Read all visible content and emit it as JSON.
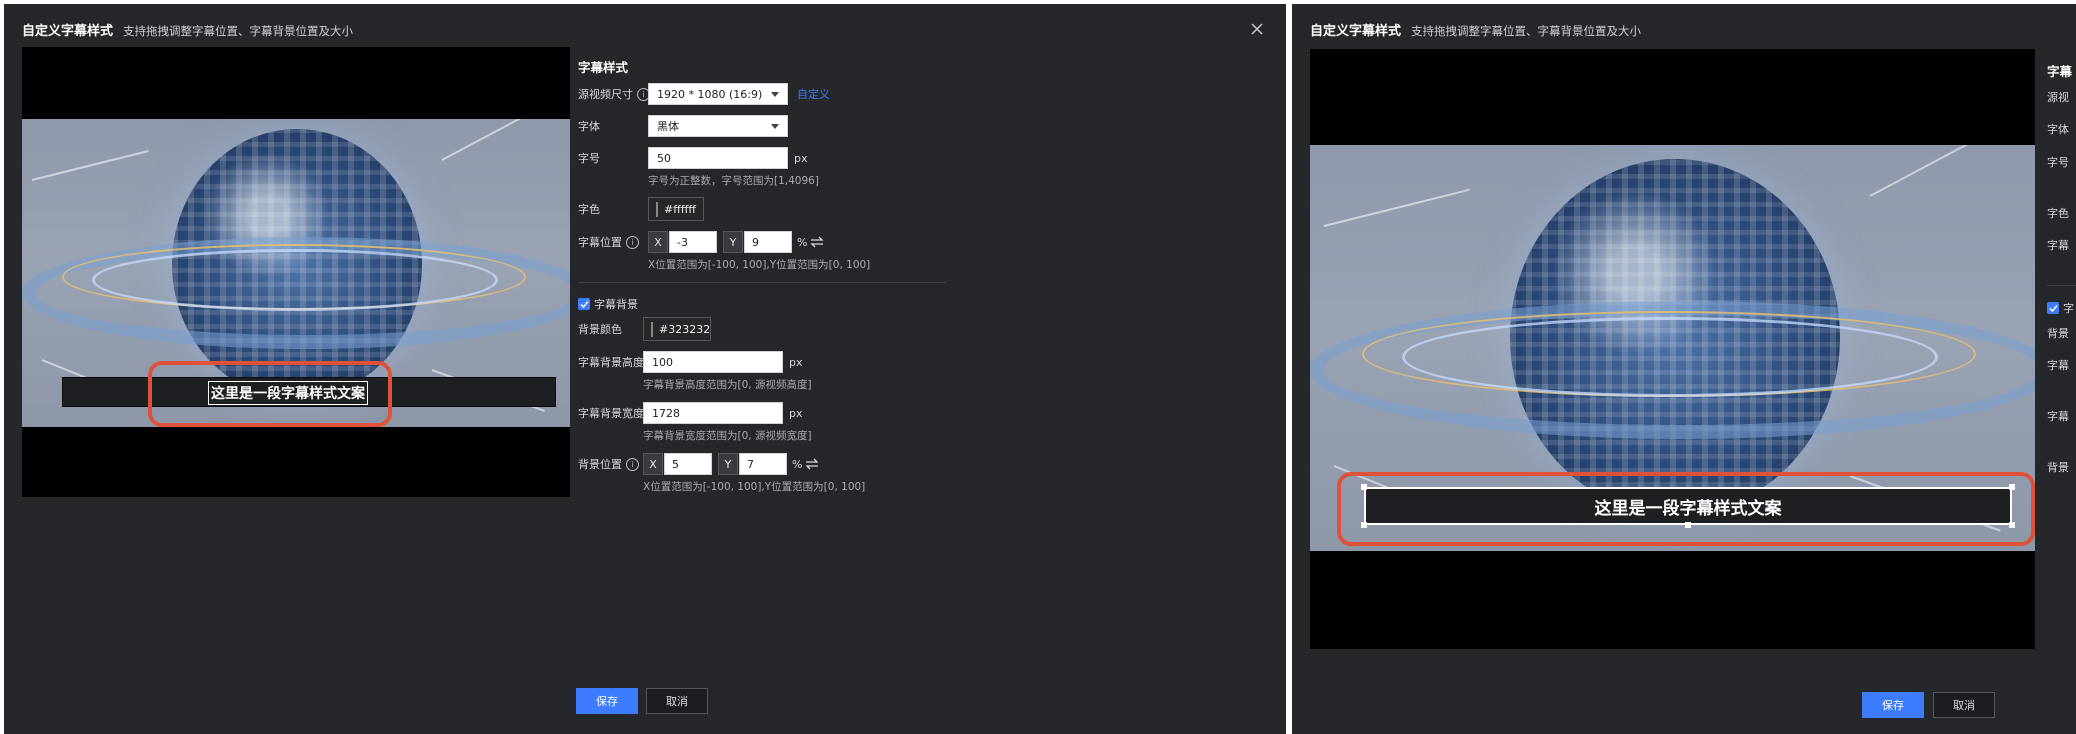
{
  "dialog": {
    "title": "自定义字幕样式",
    "subtitle": "支持拖拽调整字幕位置、字幕背景位置及大小"
  },
  "preview": {
    "subtitle_text": "这里是一段字幕样式文案"
  },
  "form": {
    "section_title": "字幕样式",
    "source_size": {
      "label": "源视频尺寸",
      "value": "1920 * 1080 (16:9)",
      "custom_link": "自定义"
    },
    "font": {
      "label": "字体",
      "value": "黑体"
    },
    "font_size": {
      "label": "字号",
      "value": "50",
      "unit": "px",
      "hint": "字号为正整数，字号范围为[1,4096]"
    },
    "font_color": {
      "label": "字色",
      "value": "#ffffff"
    },
    "subtitle_position": {
      "label": "字幕位置",
      "x_tag": "X",
      "x_value": "-3",
      "y_tag": "Y",
      "y_value": "9",
      "unit": "%",
      "hint": "X位置范围为[-100, 100],Y位置范围为[0, 100]"
    },
    "subtitle_bg": {
      "label": "字幕背景",
      "checked": true
    },
    "bg_color": {
      "label": "背景颜色",
      "value": "#323232"
    },
    "bg_height": {
      "label": "字幕背景高度",
      "value": "100",
      "unit": "px",
      "hint": "字幕背景高度范围为[0, 源视频高度]"
    },
    "bg_width": {
      "label": "字幕背景宽度",
      "value": "1728",
      "unit": "px",
      "hint": "字幕背景宽度范围为[0, 源视频宽度]"
    },
    "bg_position": {
      "label": "背景位置",
      "x_tag": "X",
      "x_value": "5",
      "y_tag": "Y",
      "y_value": "7",
      "unit": "%",
      "hint": "X位置范围为[-100, 100],Y位置范围为[0, 100]"
    }
  },
  "footer": {
    "save": "保存",
    "cancel": "取消"
  },
  "dialog2_partial_labels": {
    "section_title": "字幕",
    "source_size": "源视",
    "font": "字体",
    "font_size": "字号",
    "font_color": "字色",
    "subtitle_position": "字幕",
    "subtitle_bg": "字",
    "bg_color": "背景",
    "bg_height": "字幕",
    "bg_width": "字幕",
    "bg_position": "背景"
  },
  "colors": {
    "accent": "#3d7cff",
    "highlight": "#e0513a",
    "dialog_bg": "#26272b",
    "subtitle_bg": "#323232"
  },
  "icons": {
    "close": "close-icon",
    "info": "info-icon",
    "swap": "swap-icon",
    "check": "check-icon",
    "caret": "chevron-down-icon"
  }
}
